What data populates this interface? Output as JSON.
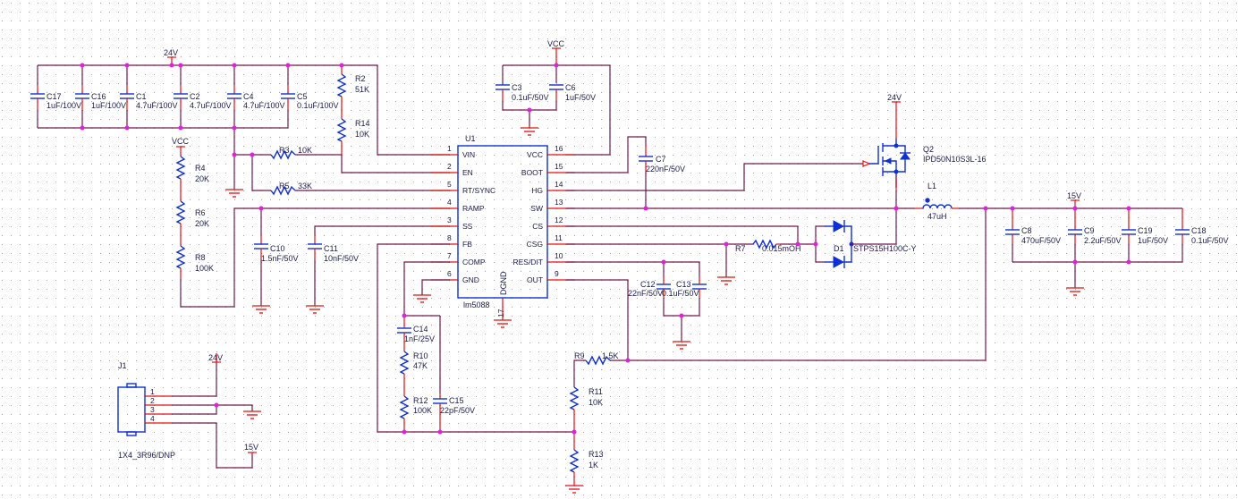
{
  "power_labels": {
    "v24_top": "24V",
    "vcc_top": "VCC",
    "vcc_left": "VCC",
    "v24_q2": "24V",
    "v15_out": "15V",
    "v24_j1": "24V",
    "v15_j1": "15V"
  },
  "input_caps": [
    {
      "ref": "C17",
      "value": "1uF/100V"
    },
    {
      "ref": "C16",
      "value": "1uF/100V"
    },
    {
      "ref": "C1",
      "value": "4.7uF/100V"
    },
    {
      "ref": "C2",
      "value": "4.7uF/100V"
    },
    {
      "ref": "C4",
      "value": "4.7uF/100V"
    },
    {
      "ref": "C5",
      "value": "0.1uF/100V"
    }
  ],
  "resistors": {
    "R2": {
      "ref": "R2",
      "value": "51K"
    },
    "R14": {
      "ref": "R14",
      "value": "10K"
    },
    "R3": {
      "ref": "R3",
      "value": "10K"
    },
    "R5": {
      "ref": "R5",
      "value": "33K"
    },
    "R4": {
      "ref": "R4",
      "value": "20K"
    },
    "R6": {
      "ref": "R6",
      "value": "20K"
    },
    "R8": {
      "ref": "R8",
      "value": "100K"
    },
    "R7": {
      "ref": "R7",
      "value": "0.015mOH"
    },
    "R9": {
      "ref": "R9",
      "value": "1.5K"
    },
    "R10": {
      "ref": "R10",
      "value": "47K"
    },
    "R11": {
      "ref": "R11",
      "value": "10K"
    },
    "R12": {
      "ref": "R12",
      "value": "100K"
    },
    "R13": {
      "ref": "R13",
      "value": "1K"
    }
  },
  "capacitors": {
    "C3": {
      "ref": "C3",
      "value": "0.1uF/50V"
    },
    "C6": {
      "ref": "C6",
      "value": "1uF/50V"
    },
    "C7": {
      "ref": "C7",
      "value": "220nF/50V"
    },
    "C10": {
      "ref": "C10",
      "value": "1.5nF/50V"
    },
    "C11": {
      "ref": "C11",
      "value": "10nF/50V"
    },
    "C12": {
      "ref": "C12",
      "value": "22nF/50V"
    },
    "C13": {
      "ref": "C13",
      "value": "0.1uF/50V"
    },
    "C14": {
      "ref": "C14",
      "value": "1nF/25V"
    },
    "C15": {
      "ref": "C15",
      "value": "22pF/50V"
    }
  },
  "output_caps": [
    {
      "ref": "C8",
      "value": "470uF/50V"
    },
    {
      "ref": "C9",
      "value": "2.2uF/50V"
    },
    {
      "ref": "C19",
      "value": "1uF/50V"
    },
    {
      "ref": "C18",
      "value": "0.1uF/50V"
    }
  ],
  "u1": {
    "ref": "U1",
    "part": "lm5088",
    "center_label": "DGND",
    "dgnd_pin": "17",
    "left_pins": [
      {
        "num": "1",
        "name": "VIN"
      },
      {
        "num": "2",
        "name": "EN"
      },
      {
        "num": "5",
        "name": "RT/SYNC"
      },
      {
        "num": "4",
        "name": "RAMP"
      },
      {
        "num": "3",
        "name": "SS"
      },
      {
        "num": "8",
        "name": "FB"
      },
      {
        "num": "7",
        "name": "COMP"
      },
      {
        "num": "6",
        "name": "GND"
      }
    ],
    "right_pins": [
      {
        "num": "16",
        "name": "VCC"
      },
      {
        "num": "15",
        "name": "BOOT"
      },
      {
        "num": "14",
        "name": "HG"
      },
      {
        "num": "13",
        "name": "SW"
      },
      {
        "num": "12",
        "name": "CS"
      },
      {
        "num": "11",
        "name": "CSG"
      },
      {
        "num": "10",
        "name": "RES/DIT"
      },
      {
        "num": "9",
        "name": "OUT"
      }
    ]
  },
  "q2": {
    "ref": "Q2",
    "part": "IPD50N10S3L-16"
  },
  "d1": {
    "ref": "D1",
    "part": "STPS15H100C-Y"
  },
  "l1": {
    "ref": "L1",
    "value": "47uH"
  },
  "j1": {
    "ref": "J1",
    "part": "1X4_3R96/DNP",
    "pins": [
      "1",
      "2",
      "3",
      "4"
    ]
  }
}
